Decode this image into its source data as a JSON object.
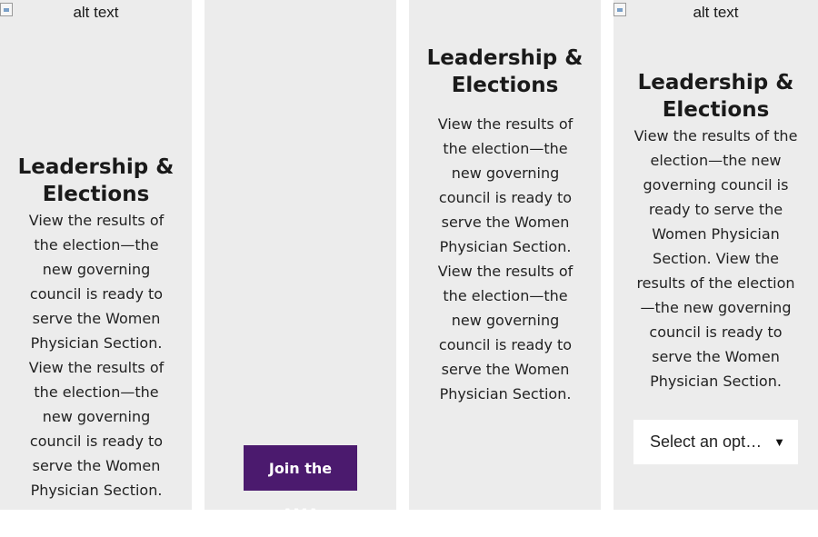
{
  "cards": [
    {
      "image_alt": "alt text",
      "title_line1": "Leadership &",
      "title_line2": "Elections",
      "body": "View the results of the election—the new governing council is ready to serve the Women Physician Section. View the results of the election—the new governing council is ready to serve the Women Physician Section."
    },
    {
      "button_label": "Join the AMA",
      "button_color": "#4b1a6e"
    },
    {
      "title_line1": "Leadership &",
      "title_line2": "Elections",
      "body": "View the results of the election—the new governing council is ready to serve the Women Physician Section. View the results of the election—the new governing council is ready to serve the Women Physician Section."
    },
    {
      "image_alt": "alt text",
      "title_line1": "Leadership &",
      "title_line2": "Elections",
      "body": "View the results of the election—the new governing council is ready to serve the Women Physician Section. View the results of the election—the new governing council is ready to serve the Women Physician Section.",
      "select_value": "Select an opt…"
    }
  ],
  "icons": {
    "broken_image": "broken-image-icon",
    "select_arrow": "chevron-down-icon"
  },
  "colors": {
    "card_background": "#ececec",
    "button_background": "#4b1a6e",
    "button_text": "#ffffff"
  }
}
